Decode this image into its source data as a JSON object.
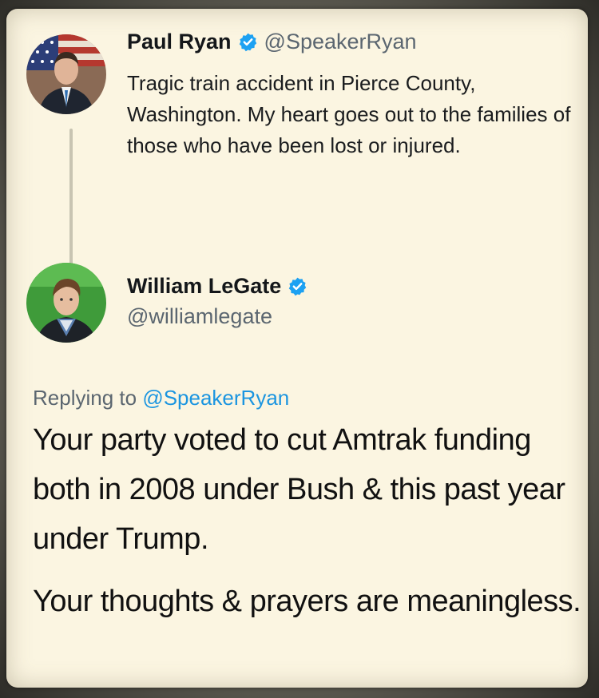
{
  "original_tweet": {
    "author_name": "Paul Ryan",
    "author_handle": "@SpeakerRyan",
    "verified": true,
    "avatar_icon": "paul-ryan-avatar",
    "text": "Tragic train accident in Pierce County, Washington. My heart goes out to the families of those who have been lost or injured."
  },
  "reply_tweet": {
    "author_name": "William LeGate",
    "author_handle": "@williamlegate",
    "verified": true,
    "avatar_icon": "william-legate-avatar",
    "replying_to_label": "Replying to",
    "replying_to_handle": "@SpeakerRyan",
    "paragraphs": [
      "Your party voted to cut Amtrak funding both in 2008 under Bush & this past year under Trump.",
      "Your thoughts & prayers are meaningless."
    ]
  },
  "colors": {
    "card_background": "#fbf5e1",
    "verified_badge": "#1da1f2",
    "mention": "#1b95e0",
    "secondary_text": "#5b6670"
  }
}
